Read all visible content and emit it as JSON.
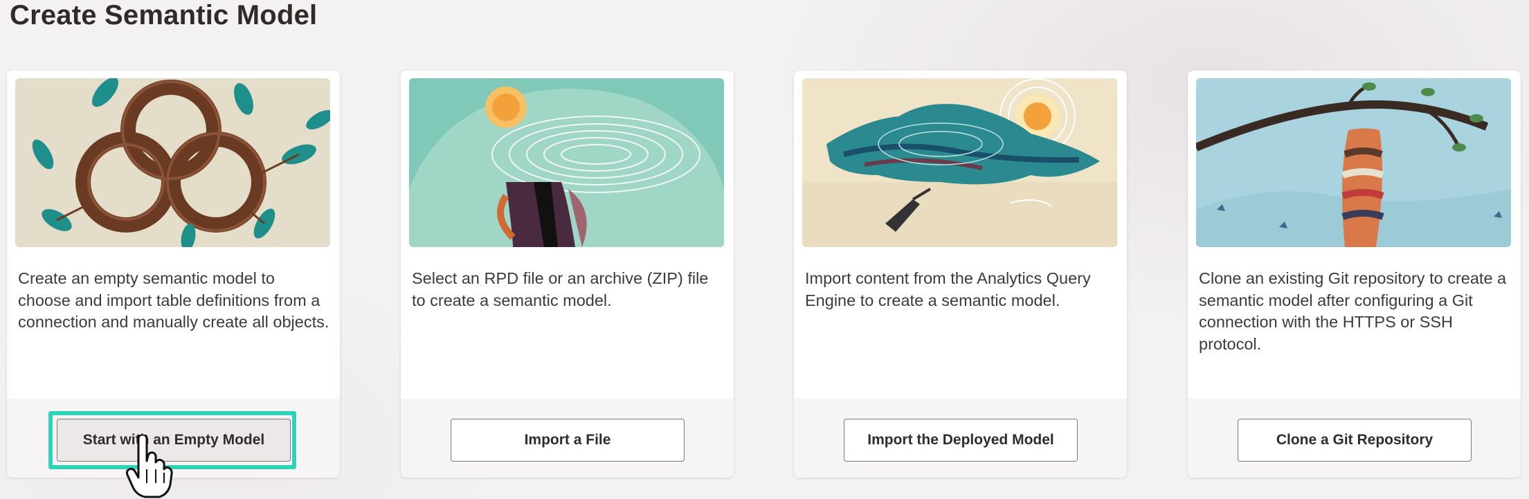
{
  "page": {
    "title": "Create Semantic Model"
  },
  "cards": [
    {
      "description": "Create an empty semantic model to choose and import table definitions from a connection and manually create all objects.",
      "button_label": "Start with an Empty Model",
      "illustration": "intertwined-rings-illustration"
    },
    {
      "description": "Select an RPD file or an archive (ZIP) file to create a semantic model.",
      "button_label": "Import a File",
      "illustration": "sun-cloud-landscape-illustration"
    },
    {
      "description": "Import content from the Analytics Query Engine to create a semantic model.",
      "button_label": "Import the Deployed Model",
      "illustration": "floating-island-illustration"
    },
    {
      "description": "Clone an existing Git repository to create a semantic model after configuring a Git connection with the HTTPS or SSH protocol.",
      "button_label": "Clone a Git Repository",
      "illustration": "branch-cocoon-illustration"
    }
  ],
  "colors": {
    "focus_ring": "#2ed3b7",
    "card_background": "#ffffff",
    "page_background": "#f3f1f2"
  }
}
